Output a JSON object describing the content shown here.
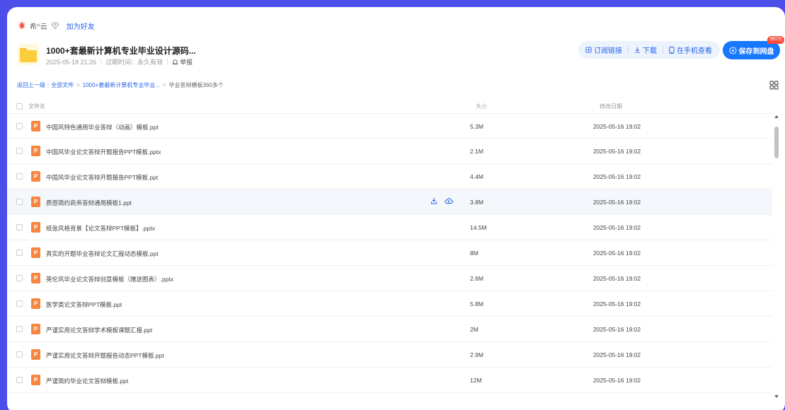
{
  "sharer": {
    "name": "希^云",
    "add_friend": "加为好友"
  },
  "share": {
    "title": "1000+套最新计算机专业毕业设计源码...",
    "date": "2025-05-18 21:26",
    "expire": "过期时间：永久有效",
    "report": "举报"
  },
  "actions": {
    "subscribe": "订阅链接",
    "download": "下载",
    "mobile": "在手机查看",
    "save": "保存到网盘",
    "badge": "领红包"
  },
  "breadcrumb": {
    "back": "返回上一级",
    "all": "全部文件",
    "folder": "1000+套最新计算机专业毕业...",
    "current": "毕业答辩模板360多个"
  },
  "columns": {
    "name": "文件名",
    "size": "大小",
    "date": "修改日期"
  },
  "colors": {
    "accent": "#1677ff",
    "link": "#2563eb",
    "ppt": "#f5853f",
    "frame": "#4b4ee8"
  },
  "files": [
    {
      "icon": "P",
      "name": "中国风特色通用毕业答辩（动画）模板.ppt",
      "size": "5.3M",
      "date": "2025-05-16 19:02"
    },
    {
      "icon": "P",
      "name": "中国风毕业论文答辩开题报告PPT模板.pptx",
      "size": "2.1M",
      "date": "2025-05-16 19:02"
    },
    {
      "icon": "P",
      "name": "中国风毕业论文答辩开题报告PPT模板.ppt",
      "size": "4.4M",
      "date": "2025-05-16 19:02"
    },
    {
      "icon": "P",
      "name": "质感简约商务答辩通用模板1.ppt",
      "size": "3.8M",
      "date": "2025-05-16 19:02"
    },
    {
      "icon": "P",
      "name": "纸张风格背景【论文答辩PPT模板】.pptx",
      "size": "14.5M",
      "date": "2025-05-16 19:02"
    },
    {
      "icon": "P",
      "name": "真实的开题毕业答辩论文汇报动态模板.ppt",
      "size": "8M",
      "date": "2025-05-16 19:02"
    },
    {
      "icon": "P",
      "name": "英伦风毕业论文答辩创意模板（赠送图表）.pptx",
      "size": "2.6M",
      "date": "2025-05-16 19:02"
    },
    {
      "icon": "P",
      "name": "医学类论文答辩PPT模板.ppt",
      "size": "5.8M",
      "date": "2025-05-16 19:02"
    },
    {
      "icon": "P",
      "name": "严谨实用论文答辩学术模板课题汇报.ppt",
      "size": "2M",
      "date": "2025-05-16 19:02"
    },
    {
      "icon": "P",
      "name": "严谨实用论文答辩开题报告动态PPT模板.ppt",
      "size": "2.9M",
      "date": "2025-05-16 19:02"
    },
    {
      "icon": "P",
      "name": "严谨简约毕业论文答辩模板.ppt",
      "size": "12M",
      "date": "2025-05-16 19:02"
    }
  ]
}
